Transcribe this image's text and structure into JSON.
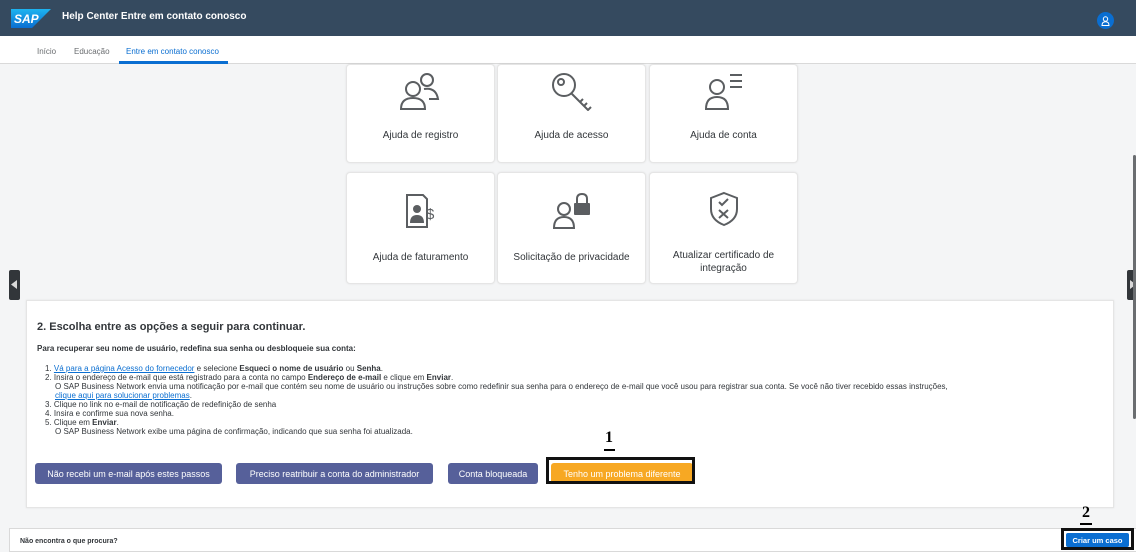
{
  "header": {
    "logo_text": "SAP",
    "title": "Help Center Entre em contato conosco",
    "avatar_icon": "user-icon"
  },
  "tabs": [
    {
      "label": "Início",
      "active": false
    },
    {
      "label": "Educação",
      "active": false
    },
    {
      "label": "Entre em contato conosco",
      "active": true
    }
  ],
  "tiles": [
    {
      "label": "Ajuda de registro",
      "icon": "users-icon"
    },
    {
      "label": "Ajuda de acesso",
      "icon": "key-icon"
    },
    {
      "label": "Ajuda de conta",
      "icon": "user-list-icon"
    },
    {
      "label": "Ajuda de faturamento",
      "icon": "invoice-icon"
    },
    {
      "label": "Solicitação de privacidade",
      "icon": "user-lock-icon"
    },
    {
      "label": "Atualizar certificado de integração",
      "icon": "shield-certificate-icon"
    }
  ],
  "options": {
    "title": "2. Escolha entre as opções a seguir para continuar.",
    "intro": "Para recuperar seu nome de usuário, redefina sua senha ou desbloqueie sua conta:",
    "step1_prefix": "1. ",
    "step1_link": "Vá para a página Acesso do fornecedor",
    "step1_mid": " e selecione ",
    "step1_bold1": "Esqueci o nome de usuário",
    "step1_or": " ou ",
    "step1_bold2": "Senha",
    "step1_end": ".",
    "step2_a": "2. Insira o endereço de e-mail que está registrado para a conta no campo ",
    "step2_bold1": "Endereço de e-mail",
    "step2_b": " e clique em ",
    "step2_bold2": "Enviar",
    "step2_c": ".",
    "step2_note": "O SAP Business Network envia uma notificação por e-mail que contém seu nome de usuário ou instruções sobre como redefinir sua senha para o endereço de e-mail que você usou para registrar sua conta. Se você não tiver recebido essas instruções,",
    "step2_link": "clique aqui para solucionar problemas",
    "step2_link_end": ".",
    "step3": "3. Clique no link no e-mail de notificação de redefinição de senha",
    "step4": "4. Insira e confirme sua nova senha.",
    "step5_a": "5. Clique em ",
    "step5_bold": "Enviar",
    "step5_b": ".",
    "step5_note": "O SAP Business Network exibe uma página de confirmação, indicando que sua senha foi atualizada.",
    "buttons": [
      "Não recebi um e-mail após estes passos",
      "Preciso reatribuir a conta do administrador",
      "Conta bloqueada",
      "Tenho um problema diferente"
    ]
  },
  "annotations": {
    "marker1": "1",
    "marker2": "2"
  },
  "footer": {
    "text": "Não encontra o que procura?",
    "create_case": "Criar um caso"
  },
  "colors": {
    "shellbar": "#354a5f",
    "accent": "#0a6ed1",
    "button": "#56609a",
    "emphasis": "#f7a823"
  }
}
